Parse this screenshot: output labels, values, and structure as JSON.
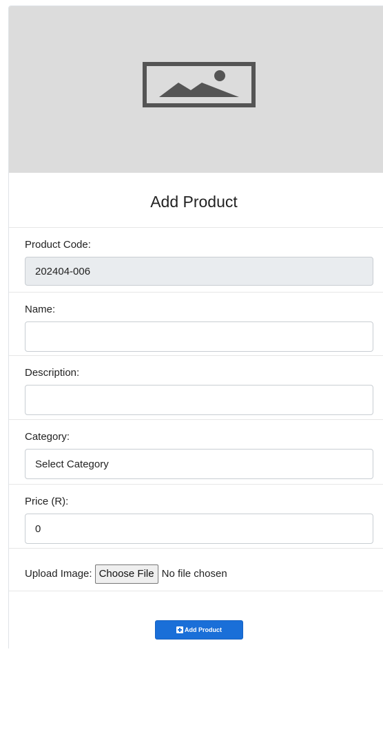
{
  "header": {
    "image_icon": "image-placeholder-icon",
    "title": "Add Product"
  },
  "form": {
    "product_code": {
      "label": "Product Code:",
      "value": "202404-006"
    },
    "name": {
      "label": "Name:",
      "value": "",
      "placeholder": ""
    },
    "description": {
      "label": "Description:",
      "value": "",
      "placeholder": ""
    },
    "category": {
      "label": "Category:",
      "selected": "Select Category"
    },
    "price": {
      "label": "Price (R):",
      "value": "0"
    },
    "upload": {
      "label": "Upload Image:",
      "button_label": "Choose File",
      "status": "No file chosen"
    },
    "submit": {
      "label": "Add Product",
      "icon": "plus-square-icon"
    }
  },
  "colors": {
    "primary": "#1a6fd8",
    "hero_bg": "#dcdcdc",
    "readonly_bg": "#e9ecef"
  }
}
